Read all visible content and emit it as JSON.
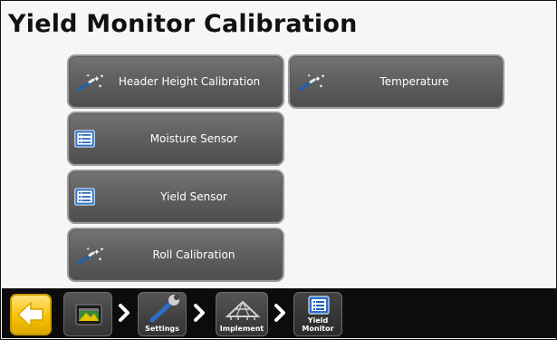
{
  "page": {
    "title": "Yield Monitor Calibration"
  },
  "buttons": {
    "header_height": {
      "label": "Header Height Calibration",
      "icon": "wand-icon"
    },
    "temperature": {
      "label": "Temperature",
      "icon": "wand-icon"
    },
    "moisture": {
      "label": "Moisture Sensor",
      "icon": "list-icon"
    },
    "yield": {
      "label": "Yield Sensor",
      "icon": "list-icon"
    },
    "roll": {
      "label": "Roll Calibration",
      "icon": "wand-icon"
    }
  },
  "breadcrumb": {
    "settings": "Settings",
    "implement": "Implement",
    "yield_monitor_line1": "Yield",
    "yield_monitor_line2": "Monitor"
  },
  "colors": {
    "accent": "#f5c000",
    "button": "#606060",
    "bar": "#0c0c0c",
    "icon_blue": "#2a6fc4"
  }
}
